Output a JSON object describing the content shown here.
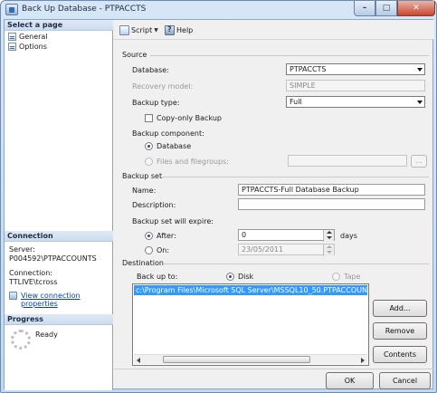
{
  "window": {
    "title": "Back Up Database - PTPACCTS"
  },
  "left": {
    "select_page_header": "Select a page",
    "pages": [
      {
        "label": "General",
        "icon": "page-icon"
      },
      {
        "label": "Options",
        "icon": "page-icon"
      }
    ],
    "connection_header": "Connection",
    "server_label": "Server:",
    "server_value": "P004592\\PTPACCOUNTS",
    "connection_label": "Connection:",
    "connection_value": "TTLIVE\\tcross",
    "view_connection_link": "View connection properties",
    "progress_header": "Progress",
    "progress_status": "Ready"
  },
  "toolbar": {
    "script_label": "Script",
    "help_label": "Help"
  },
  "source": {
    "group_label": "Source",
    "database_label": "Database:",
    "database_value": "PTPACCTS",
    "recovery_label": "Recovery model:",
    "recovery_value": "SIMPLE",
    "backup_type_label": "Backup type:",
    "backup_type_value": "Full",
    "copy_only_label": "Copy-only Backup",
    "copy_only_checked": false,
    "component_label": "Backup component:",
    "component_database_label": "Database",
    "component_files_label": "Files and filegroups:",
    "files_browse_label": "..."
  },
  "backup_set": {
    "group_label": "Backup set",
    "name_label": "Name:",
    "name_value": "PTPACCTS-Full Database Backup",
    "description_label": "Description:",
    "description_value": "",
    "expire_label": "Backup set will expire:",
    "after_label": "After:",
    "after_value": "0",
    "days_label": "days",
    "on_label": "On:",
    "on_value": "23/05/2011"
  },
  "destination": {
    "group_label": "Destination",
    "backup_to_label": "Back up to:",
    "disk_label": "Disk",
    "tape_label": "Tape",
    "paths": [
      "c:\\Program Files\\Microsoft SQL Server\\MSSQL10_50.PTPACCOUNTS\\MSSQL"
    ],
    "add_label": "Add...",
    "remove_label": "Remove",
    "contents_label": "Contents"
  },
  "footer": {
    "ok_label": "OK",
    "cancel_label": "Cancel"
  }
}
